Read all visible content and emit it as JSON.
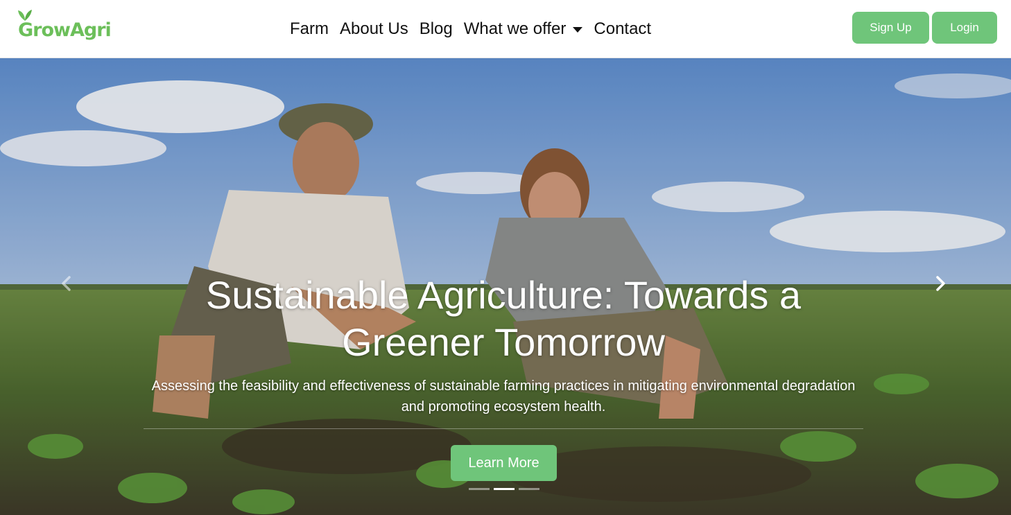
{
  "brand": {
    "name": "GrowAgri",
    "color": "#6cbf5a"
  },
  "nav": {
    "links": [
      {
        "label": "Farm"
      },
      {
        "label": "About Us"
      },
      {
        "label": "Blog"
      },
      {
        "label": "What we offer",
        "dropdown": true
      },
      {
        "label": "Contact"
      }
    ]
  },
  "auth": {
    "signup_label": "Sign Up",
    "login_label": "Login",
    "button_color": "#6fc57a"
  },
  "hero": {
    "title": "Sustainable Agriculture: Towards a Greener Tomorrow",
    "subtitle": "Assessing the feasibility and effectiveness of sustainable farming practices in mitigating environmental degradation and promoting ecosystem health.",
    "cta_label": "Learn More",
    "prev_icon": "chevron-left-icon",
    "next_icon": "chevron-right-icon",
    "slide_count": 3,
    "active_slide": 2
  }
}
